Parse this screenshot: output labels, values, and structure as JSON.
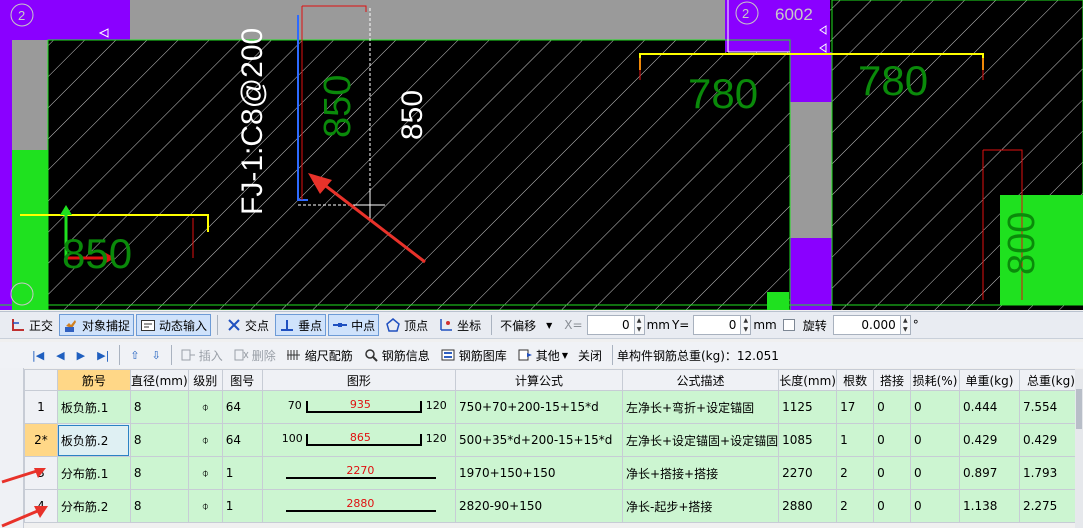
{
  "canvas": {
    "markers": {
      "circle_left": "2",
      "circle_right": "2",
      "top_right_label": "6002"
    },
    "dims": {
      "d850_small_left": "850",
      "d850_vertical_green": "850",
      "d850_vertical_white": "850",
      "d780_left": "780",
      "d780_right": "780",
      "d800_right": "800"
    },
    "rebar_label": "FJ-1:C8@200",
    "colors": {
      "purple": "#7a00ff",
      "green": "#1fe11f",
      "dim_text": "#0a8a0a",
      "yellow": "#ffff00",
      "red_arrow": "#e8322a"
    }
  },
  "snapbar": {
    "ortho": "正交",
    "object_snap": "对象捕捉",
    "dynamic_input": "动态输入",
    "intersection": "交点",
    "perpendicular": "垂点",
    "midpoint": "中点",
    "vertex": "顶点",
    "coordinate": "坐标",
    "offset_select": "不偏移",
    "x_label": "X=",
    "x_value": "0",
    "x_unit": "mm",
    "y_label": "Y=",
    "y_value": "0",
    "y_unit": "mm",
    "rotate": "旋转",
    "rotate_value": "0.000",
    "deg": "°"
  },
  "toolbar2": {
    "insert": "插入",
    "delete": "删除",
    "scale_rebar": "缩尺配筋",
    "rebar_info": "钢筋信息",
    "rebar_library": "钢筋图库",
    "other": "其他",
    "close": "关闭",
    "total_weight": "单构件钢筋总重(kg)：12.051"
  },
  "table": {
    "headers": [
      "",
      "筋号",
      "直径(mm)",
      "级别",
      "图号",
      "图形",
      "计算公式",
      "公式描述",
      "长度(mm)",
      "根数",
      "搭接",
      "损耗(%)",
      "单重(kg)",
      "总重(kg)"
    ],
    "rows": [
      {
        "num": "1",
        "name": "板负筋.1",
        "dia": "8",
        "grade": "⌽",
        "fig": "64",
        "shape_left": "70",
        "shape_mid": "935",
        "shape_right": "120",
        "formula": "750+70+200-15+15*d",
        "desc": "左净长+弯折+设定锚固",
        "length": "1125",
        "count": "17",
        "lap": "0",
        "loss": "0",
        "unit_w": "0.444",
        "total_w": "7.554"
      },
      {
        "num": "2*",
        "name": "板负筋.2",
        "dia": "8",
        "grade": "⌽",
        "fig": "64",
        "shape_left": "100",
        "shape_mid": "865",
        "shape_right": "120",
        "formula": "500+35*d+200-15+15*d",
        "desc": "左净长+设定锚固+设定锚固",
        "length": "1085",
        "count": "1",
        "lap": "0",
        "loss": "0",
        "unit_w": "0.429",
        "total_w": "0.429"
      },
      {
        "num": "3",
        "name": "分布筋.1",
        "dia": "8",
        "grade": "⌽",
        "fig": "1",
        "shape_left": "",
        "shape_mid": "2270",
        "shape_right": "",
        "formula": "1970+150+150",
        "desc": "净长+搭接+搭接",
        "length": "2270",
        "count": "2",
        "lap": "0",
        "loss": "0",
        "unit_w": "0.897",
        "total_w": "1.793"
      },
      {
        "num": "4",
        "name": "分布筋.2",
        "dia": "8",
        "grade": "⌽",
        "fig": "1",
        "shape_left": "",
        "shape_mid": "2880",
        "shape_right": "",
        "formula": "2820-90+150",
        "desc": "净长-起步+搭接",
        "length": "2880",
        "count": "2",
        "lap": "0",
        "loss": "0",
        "unit_w": "1.138",
        "total_w": "2.275"
      }
    ]
  }
}
